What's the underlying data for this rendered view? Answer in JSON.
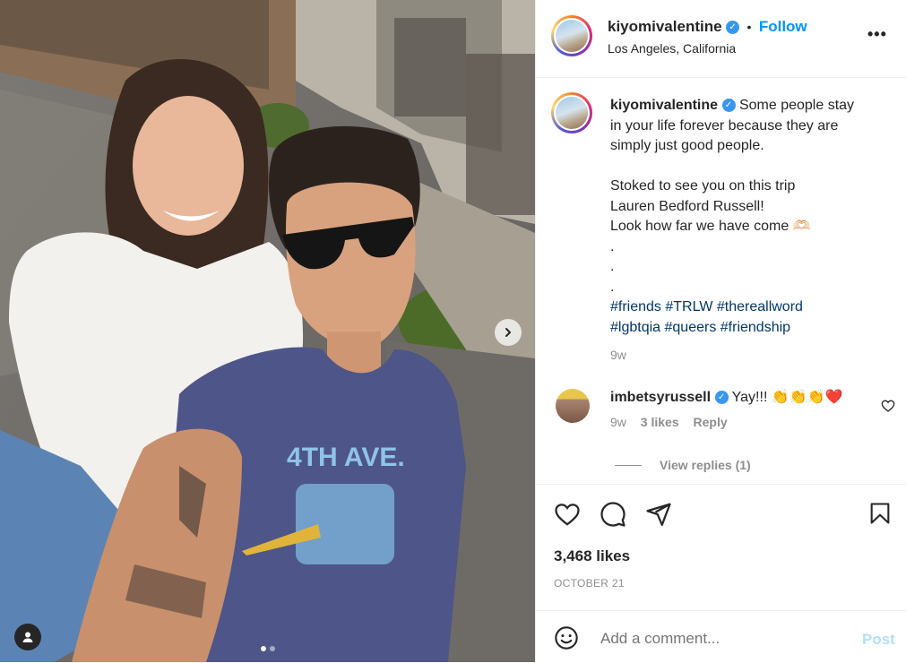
{
  "post": {
    "username": "kiyomivalentine",
    "follow_label": "Follow",
    "separator": "•",
    "location": "Los Angeles, California",
    "caption_text_lines": [
      "Some people stay",
      "in your life forever because they are",
      "simply just good people.",
      "",
      "Stoked to see you on this trip",
      "Lauren Bedford Russell!",
      "Look how far we have come 🫶🏻",
      ".",
      ".",
      "."
    ],
    "hashtags_line1": [
      "#friends",
      "#TRLW",
      "#thereallword"
    ],
    "hashtags_line2": [
      "#lgbtqia",
      "#queers",
      "#friendship"
    ],
    "caption_time": "9w",
    "likes": "3,468 likes",
    "date": "OCTOBER 21",
    "photo_index": 1,
    "photo_count": 2
  },
  "comment": {
    "username": "imbetsyrussell",
    "text": "Yay!!! 👏👏👏❤️",
    "time": "9w",
    "likes": "3 likes",
    "reply_label": "Reply",
    "view_replies": "View replies (1)"
  },
  "composer": {
    "placeholder": "Add a comment...",
    "post_label": "Post"
  },
  "icons": {
    "heart": "heart-icon",
    "comment": "comment-icon",
    "share": "share-icon",
    "save": "bookmark-icon",
    "emoji": "emoji-icon",
    "more": "more-icon",
    "next": "chevron-right-icon",
    "user_tag": "user-tag-icon"
  },
  "colors": {
    "accent": "#0095f6",
    "hashtag": "#00376b",
    "verified": "#3897f0",
    "heart_red": "#ed4956",
    "muted": "#8e8e8e"
  }
}
